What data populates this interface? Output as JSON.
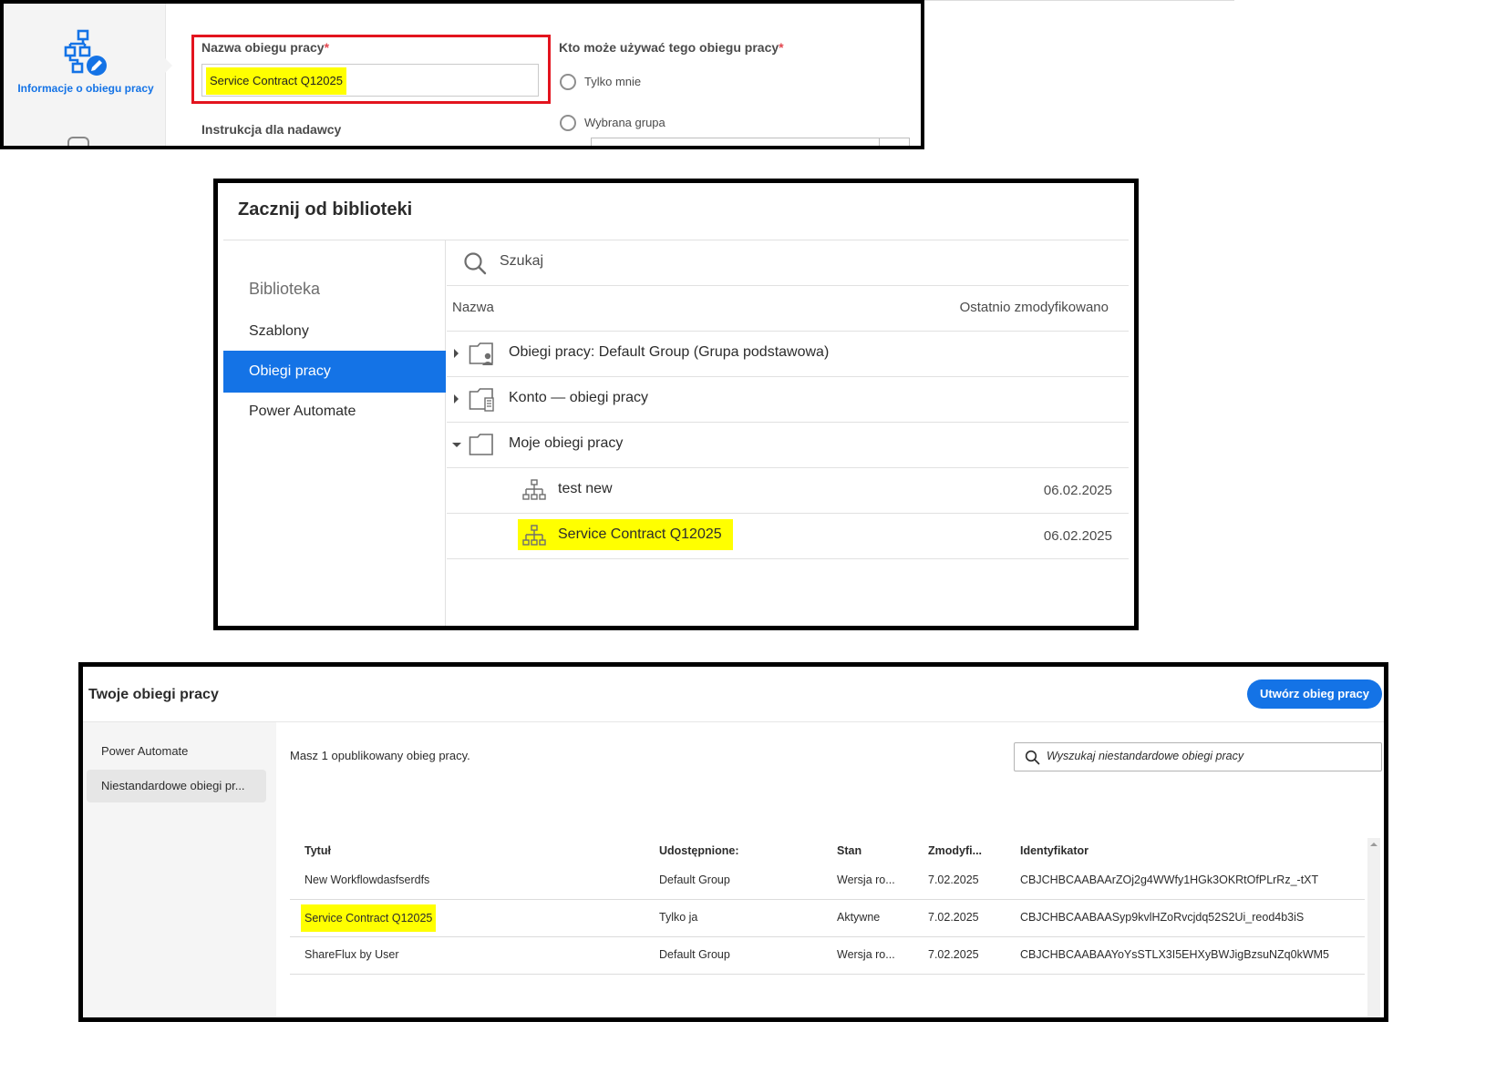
{
  "panel1": {
    "sidebar_label": "Informacje o obiegu pracy",
    "name_label": "Nazwa obiegu pracy",
    "required_mark": "*",
    "name_value": "Service Contract Q12025",
    "who_label": "Kto może używać tego obiegu pracy",
    "radio_only_me": "Tylko mnie",
    "radio_group": "Wybrana grupa",
    "sender_instructions_label": "Instrukcja dla nadawcy",
    "accent_color": "#1473e6",
    "highlight_border_color": "#e3141e",
    "icons": [
      "workflow-edit-icon"
    ]
  },
  "panel2": {
    "title": "Zacznij od biblioteki",
    "sidebar": {
      "heading": "Biblioteka",
      "items": [
        "Szablony",
        "Obiegi pracy",
        "Power Automate"
      ],
      "active_index": 1
    },
    "search_placeholder": "Szukaj",
    "columns": {
      "name": "Nazwa",
      "modified": "Ostatnio zmodyfikowano"
    },
    "rows": [
      {
        "name": "Obiegi pracy: Default Group (Grupa podstawowa)",
        "date": "",
        "icon": "group-folder-icon",
        "expanded": false
      },
      {
        "name": "Konto — obiegi pracy",
        "date": "",
        "icon": "account-folder-icon",
        "expanded": false
      },
      {
        "name": "Moje obiegi pracy",
        "date": "",
        "icon": "folder-icon",
        "expanded": true
      },
      {
        "name": "test new",
        "date": "06.02.2025",
        "icon": "workflow-icon"
      },
      {
        "name": "Service Contract Q12025",
        "date": "06.02.2025",
        "icon": "workflow-icon",
        "highlighted": true
      }
    ]
  },
  "panel3": {
    "title": "Twoje obiegi pracy",
    "create_button": "Utwórz obieg pracy",
    "sidebar": [
      "Power Automate",
      "Niestandardowe obiegi pr..."
    ],
    "active_index": 1,
    "published_count_text": "Masz 1 opublikowany obieg pracy.",
    "search_placeholder": "Wyszukaj niestandardowe obiegi pracy",
    "columns": [
      "Tytuł",
      "Udostępnione:",
      "Stan",
      "Zmodyfi...",
      "Identyfikator"
    ],
    "rows": [
      [
        "New Workflowdasfserdfs",
        "Default Group",
        "Wersja ro...",
        "7.02.2025",
        "CBJCHBCAABAArZOj2g4WWfy1HGk3OKRtOfPLrRz_-tXT"
      ],
      [
        "Service Contract Q12025",
        "Tylko ja",
        "Aktywne",
        "7.02.2025",
        "CBJCHBCAABAASyp9kvlHZoRvcjdq52S2Ui_reod4b3iS"
      ],
      [
        "ShareFlux by User",
        "Default Group",
        "Wersja ro...",
        "7.02.2025",
        "CBJCHBCAABAAYoYsSTLX3I5EHXyBWJigBzsuNZq0kWM5"
      ]
    ],
    "highlight_row": 1,
    "button_color": "#1473e6",
    "highlight_color": "#ffff00"
  }
}
